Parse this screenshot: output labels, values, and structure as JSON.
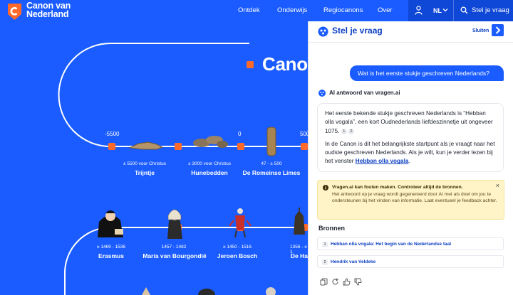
{
  "brand": {
    "name_line1": "Canon van",
    "name_line2": "Nederland"
  },
  "nav": {
    "items": [
      {
        "label": "Ontdek"
      },
      {
        "label": "Onderwijs"
      },
      {
        "label": "Regiocanons"
      },
      {
        "label": "Over"
      }
    ],
    "language": "NL",
    "ask_label": "Stel je vraag"
  },
  "timeline": {
    "title": "Canon",
    "years": [
      "-5500",
      "0",
      "500"
    ],
    "row1": [
      {
        "sub": "± 5500 voor Christus",
        "title": "Trijntje"
      },
      {
        "sub": "± 3000 voor Christus",
        "title": "Hunebedden"
      },
      {
        "sub": "47 - ± 500",
        "title": "De Romeinse Limes"
      }
    ],
    "row2": [
      {
        "sub": "± 1469 - 1536",
        "title": "Erasmus"
      },
      {
        "sub": "1457 - 1482",
        "title": "Maria van Bourgondië"
      },
      {
        "sub": "± 1450 - 1516",
        "title": "Jeroen Bosch"
      },
      {
        "sub": "1356 - ± 1",
        "title": "De Ha"
      }
    ]
  },
  "panel": {
    "title": "Stel je vraag",
    "close_label": "Sluiten",
    "question": "Wat is het eerste stukje geschreven Nederlands?",
    "answer_label": "AI antwoord van vragen.ai",
    "answer_p1": "Het eerste bekende stukje geschreven Nederlands is “Hebban olla vogala”, een kort Oudnederlands liefdeszinnetje uit ongeveer 1075.",
    "cite1": "1",
    "cite2": "2",
    "answer_p2": "In de Canon is dit het belangrijkste startpunt als je vraagt naar het oudste geschreven Nederlands. Als je wilt, kun je verder lezen bij het venster",
    "answer_link": "Hebban olla vogala",
    "answer_end": ".",
    "warning_title": "Vragen.ai kan fouten maken. Controleer altijd de bronnen.",
    "warning_body": "Het antwoord op je vraag wordt gegenereerd door AI met als doel om jou te ondersteunen bij het vinden van informatie. Laat eventueel je feedback achter.",
    "sources_title": "Bronnen",
    "sources": [
      {
        "num": "1",
        "title": "Hebban olla vogala: Het begin van de Nederlandse taal"
      },
      {
        "num": "2",
        "title": "Hendrik van Veldeke"
      }
    ]
  },
  "colors": {
    "brand_blue": "#1a5cff",
    "accent_orange": "#ff6a2b",
    "dark_blue": "#0c3fc2"
  }
}
